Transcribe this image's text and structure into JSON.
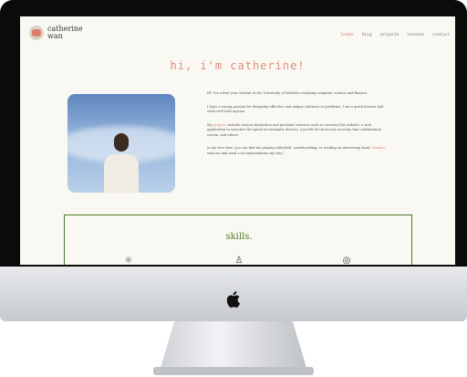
{
  "site": {
    "logo_line1": "catherine",
    "logo_line2": "wan",
    "nav": [
      "home",
      "blog",
      "projects",
      "resume",
      "contact"
    ]
  },
  "hero": {
    "title": "hi, i'm catherine!"
  },
  "bio": {
    "p1": "Hi! I'm a first year student at the University of Waterloo studying computer science and finance.",
    "p2": "I have a strong passion for designing effective and unique solutions to problems. I am a quick learner and work well with anyone.",
    "p3_pre": "My ",
    "p3_link": "projects",
    "p3_post": " include various hackathon and personal ventures such as creating this website, a web application to visualize the speed of automatic devices, a jsx file for showcase stovemy that confirmation screen, and others.",
    "p4_pre": "In my free time, you can find me playing volleyball, snowboarding, or reading an interesting book. ",
    "p4_link": "Connect",
    "p4_post": " with me and send a recommendation my way!"
  },
  "skills": {
    "title": "skills."
  },
  "colors": {
    "accent": "#e0806f",
    "green": "#4e7b2a",
    "screen_bg": "#faf8f3"
  }
}
